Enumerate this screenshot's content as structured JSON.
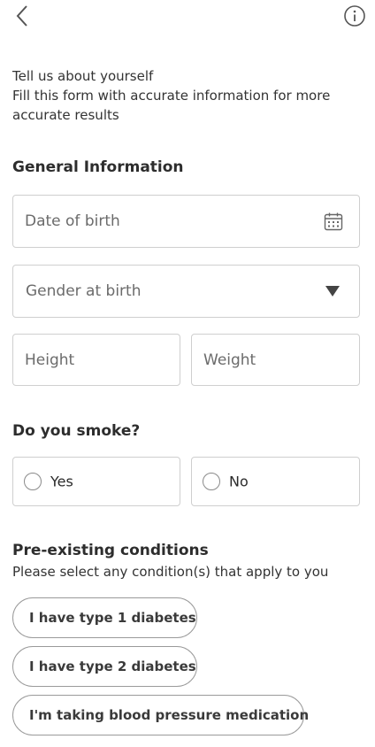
{
  "header": {
    "back_icon": "chevron-left-icon",
    "info_icon": "info-circle-icon"
  },
  "intro": {
    "line1": "Tell us about yourself",
    "line2": "Fill this form with accurate information for more accurate results"
  },
  "general": {
    "title": "General Information",
    "dob_placeholder": "Date of birth",
    "dob_icon": "calendar-icon",
    "gender_placeholder": "Gender at birth",
    "gender_icon": "caret-down-icon",
    "height_placeholder": "Height",
    "weight_placeholder": "Weight"
  },
  "smoke": {
    "title": "Do you smoke?",
    "yes_label": "Yes",
    "no_label": "No"
  },
  "conditions": {
    "title": "Pre-existing conditions",
    "subtitle": "Please select any condition(s) that apply to you",
    "items": [
      {
        "label": "I have type 1 diabetes"
      },
      {
        "label": "I have type 2 diabetes"
      },
      {
        "label": "I'm taking blood pressure medication"
      }
    ]
  },
  "colors": {
    "border": "#cfcfcf",
    "chip_border": "#9a9a9a",
    "text": "#2b2b2b",
    "placeholder": "#6b6b6b"
  }
}
